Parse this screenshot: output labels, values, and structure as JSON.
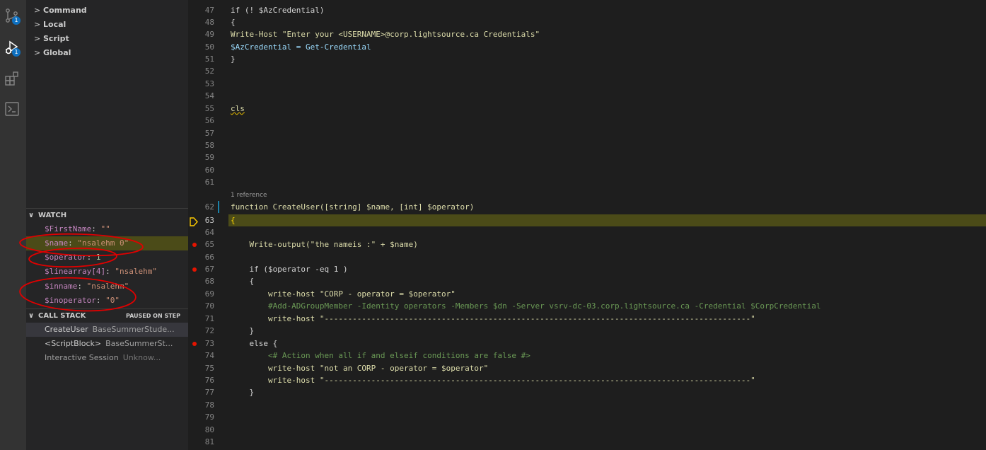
{
  "activity_bar": {
    "scm_badge": "1",
    "debug_badge": "1"
  },
  "variables": {
    "items": [
      {
        "chevron": ">",
        "label": "Command"
      },
      {
        "chevron": ">",
        "label": "Local"
      },
      {
        "chevron": ">",
        "label": "Script"
      },
      {
        "chevron": ">",
        "label": "Global"
      }
    ]
  },
  "watch": {
    "chevron": "∨",
    "title": "WATCH",
    "items": [
      {
        "name": "$FirstName",
        "sep": ": ",
        "value": "\"\""
      },
      {
        "name": "$name",
        "sep": ": ",
        "value": "\"nsalehm 0\""
      },
      {
        "name": "$operator",
        "sep": ": ",
        "value": "1"
      },
      {
        "name": "$linearray[4]",
        "sep": ": ",
        "value": "\"nsalehm\""
      },
      {
        "name": "$inname",
        "sep": ": ",
        "value": "\"nsalehm\""
      },
      {
        "name": "$inoperator",
        "sep": ": ",
        "value": "\"0\""
      }
    ]
  },
  "call_stack": {
    "chevron": "∨",
    "title": "CALL STACK",
    "status": "PAUSED ON STEP",
    "frames": [
      {
        "fn": "CreateUser",
        "file": "BaseSummerStude..."
      },
      {
        "fn": "<ScriptBlock>",
        "file": "BaseSummerSt..."
      },
      {
        "fn": "Interactive Session",
        "file": "Unknow..."
      }
    ]
  },
  "editor": {
    "code_lens": "1 reference",
    "lines": [
      {
        "n": "47",
        "t": "if (! $AzCredential)"
      },
      {
        "n": "48",
        "t": "{"
      },
      {
        "n": "49",
        "t": "Write-Host \"Enter your <USERNAME>@corp.lightsource.ca Credentials\""
      },
      {
        "n": "50",
        "t": "$AzCredential = Get-Credential"
      },
      {
        "n": "51",
        "t": "}"
      },
      {
        "n": "52",
        "t": ""
      },
      {
        "n": "53",
        "t": ""
      },
      {
        "n": "54",
        "t": ""
      },
      {
        "n": "55",
        "t": "cls"
      },
      {
        "n": "56",
        "t": ""
      },
      {
        "n": "57",
        "t": ""
      },
      {
        "n": "58",
        "t": ""
      },
      {
        "n": "59",
        "t": ""
      },
      {
        "n": "60",
        "t": ""
      },
      {
        "n": "61",
        "t": ""
      },
      {
        "n": "62",
        "t": "function CreateUser([string] $name, [int] $operator)"
      },
      {
        "n": "63",
        "t": "{"
      },
      {
        "n": "64",
        "t": ""
      },
      {
        "n": "65",
        "t": "    Write-output(\"the nameis :\" + $name)"
      },
      {
        "n": "66",
        "t": ""
      },
      {
        "n": "67",
        "t": "    if ($operator -eq 1 )"
      },
      {
        "n": "68",
        "t": "    {"
      },
      {
        "n": "69",
        "t": "        write-host \"CORP - operator = $operator\""
      },
      {
        "n": "70",
        "t": "        #Add-ADGroupMember -Identity operators -Members $dn -Server vsrv-dc-03.corp.lightsource.ca -Credential $CorpCredential"
      },
      {
        "n": "71",
        "t": "        write-host \"-------------------------------------------------------------------------------------------\""
      },
      {
        "n": "72",
        "t": "    }"
      },
      {
        "n": "73",
        "t": "    else {"
      },
      {
        "n": "74",
        "t": "        <# Action when all if and elseif conditions are false #>"
      },
      {
        "n": "75",
        "t": "        write-host \"not an CORP - operator = $operator\""
      },
      {
        "n": "76",
        "t": "        write-host \"-------------------------------------------------------------------------------------------\""
      },
      {
        "n": "77",
        "t": "    }"
      },
      {
        "n": "78",
        "t": ""
      },
      {
        "n": "79",
        "t": ""
      },
      {
        "n": "80",
        "t": ""
      },
      {
        "n": "81",
        "t": ""
      }
    ]
  },
  "colors": {
    "annotation_red": "#e00000",
    "breakpoint": "#e51400",
    "current_line_highlight": "#4b4b18",
    "debug_arrow": "#ffcc00"
  }
}
